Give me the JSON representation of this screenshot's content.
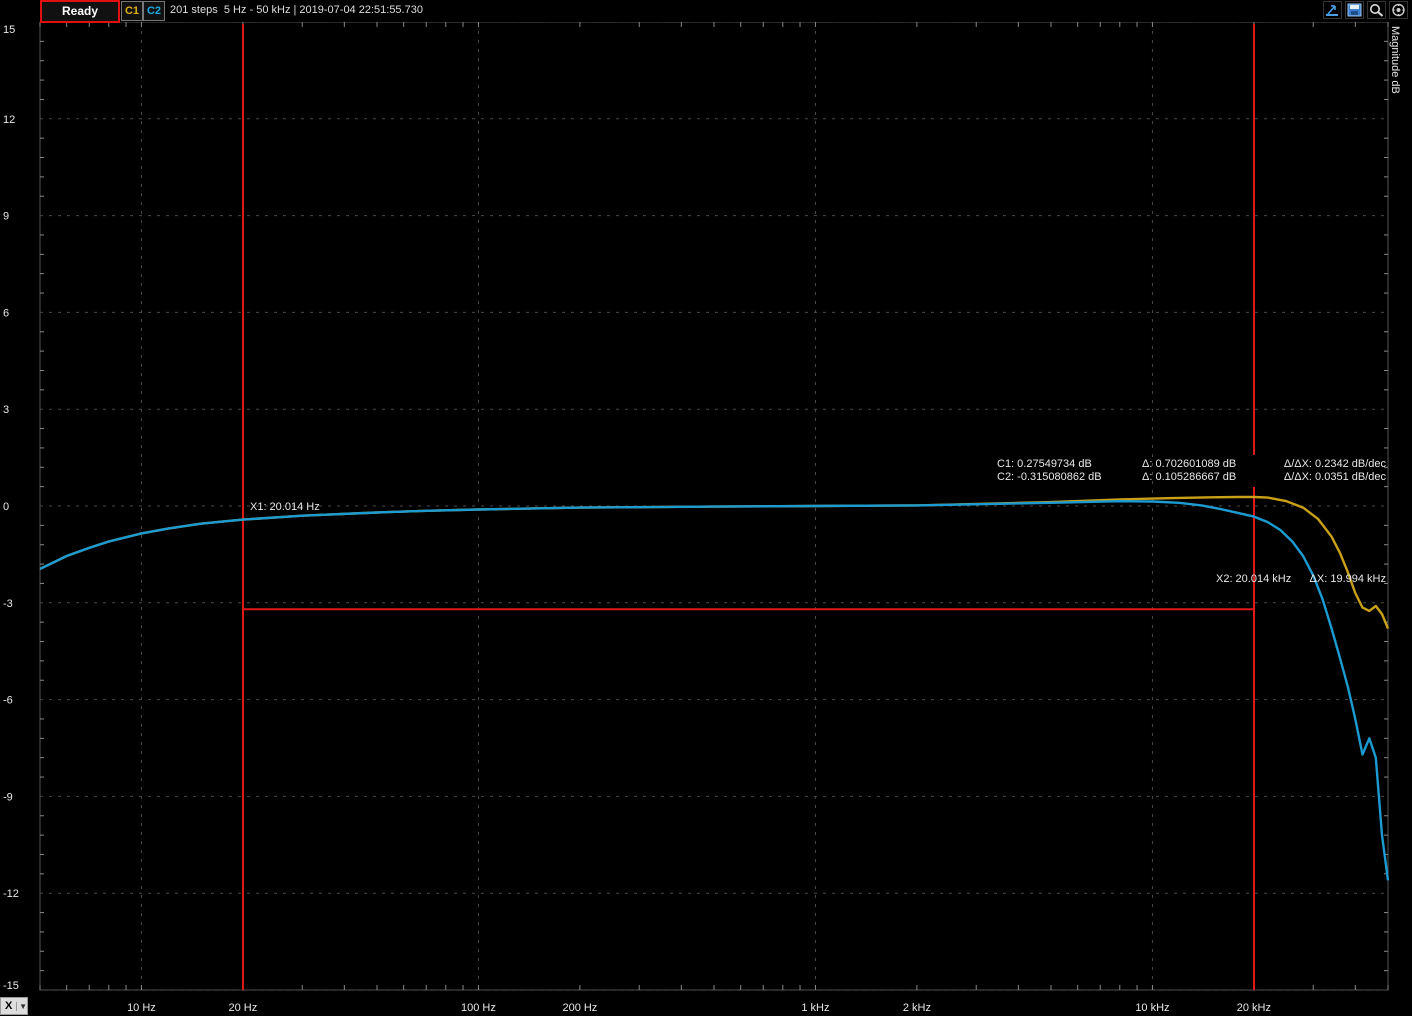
{
  "toolbar": {
    "status": "Ready",
    "channel1_label": "C1",
    "channel2_label": "C2",
    "info": "201 steps  5 Hz - 50 kHz | 2019-07-04 22:51:55.730",
    "icons": [
      "cursor-icon",
      "save-icon",
      "zoom-icon",
      "settings-icon"
    ]
  },
  "x_selector": {
    "label": "X"
  },
  "colors": {
    "c1": "#c9a018",
    "c2": "#1c9bd2",
    "cursor": "#e01818",
    "grid": "#4a4a4a"
  },
  "cursors": {
    "x1_label": "X1: 20.014 Hz",
    "x2_label": "X2: 20.014 kHz",
    "dx_label": "ΔX: 19.994 kHz",
    "c1_value": "C1: 0.27549734 dB",
    "c2_value": "C2: -0.315080862 dB",
    "d1_value": "Δ: 0.702601089 dB",
    "d2_value": "Δ: 0.105286667 dB",
    "s1_value": "Δ/ΔX: 0.2342 dB/dec",
    "s2_value": "Δ/ΔX: 0.0351 dB/dec",
    "x1_hz": 20.014,
    "x2_hz": 20014,
    "y_level_db": -3.2
  },
  "chart_data": {
    "type": "line",
    "title": "",
    "xlabel": "",
    "ylabel": "Magnitude dB",
    "x_scale": "log",
    "xlim": [
      5,
      50000
    ],
    "ylim": [
      -15,
      15
    ],
    "grid": true,
    "y_ticks": [
      "15",
      "12",
      "9",
      "6",
      "3",
      "0",
      "-3",
      "-6",
      "-9",
      "-12",
      "-15"
    ],
    "x_ticks": [
      {
        "hz": 10,
        "label": "10 Hz"
      },
      {
        "hz": 20,
        "label": "20 Hz"
      },
      {
        "hz": 100,
        "label": "100 Hz"
      },
      {
        "hz": 200,
        "label": "200 Hz"
      },
      {
        "hz": 1000,
        "label": "1 kHz"
      },
      {
        "hz": 2000,
        "label": "2 kHz"
      },
      {
        "hz": 10000,
        "label": "10 kHz"
      },
      {
        "hz": 20000,
        "label": "20 kHz"
      }
    ],
    "series": [
      {
        "name": "C1",
        "x": [
          5,
          6,
          7,
          8,
          10,
          12,
          15,
          20,
          30,
          50,
          70,
          100,
          200,
          500,
          1000,
          2000,
          5000,
          8000,
          10000,
          12000,
          15000,
          18000,
          20000,
          22000,
          25000,
          28000,
          31000,
          34000,
          36000,
          38000,
          40000,
          42000,
          44000,
          46000,
          48000,
          50000
        ],
        "y": [
          -1.95,
          -1.55,
          -1.3,
          -1.1,
          -0.85,
          -0.7,
          -0.55,
          -0.42,
          -0.3,
          -0.2,
          -0.15,
          -0.11,
          -0.05,
          -0.02,
          0.0,
          0.02,
          0.12,
          0.2,
          0.23,
          0.25,
          0.27,
          0.28,
          0.28,
          0.26,
          0.15,
          -0.05,
          -0.4,
          -0.95,
          -1.45,
          -2.05,
          -2.7,
          -3.15,
          -3.25,
          -3.1,
          -3.35,
          -3.8
        ]
      },
      {
        "name": "C2",
        "x": [
          5,
          6,
          7,
          8,
          10,
          12,
          15,
          20,
          30,
          50,
          70,
          100,
          200,
          500,
          1000,
          2000,
          5000,
          8000,
          10000,
          12000,
          14000,
          16000,
          18000,
          20000,
          22000,
          24000,
          26000,
          28000,
          30000,
          32000,
          34000,
          36000,
          38000,
          40000,
          42000,
          44000,
          46000,
          48000,
          50000
        ],
        "y": [
          -1.95,
          -1.55,
          -1.3,
          -1.1,
          -0.85,
          -0.7,
          -0.55,
          -0.42,
          -0.3,
          -0.2,
          -0.15,
          -0.11,
          -0.05,
          -0.02,
          0.0,
          0.02,
          0.1,
          0.15,
          0.14,
          0.1,
          0.02,
          -0.1,
          -0.22,
          -0.33,
          -0.5,
          -0.75,
          -1.1,
          -1.55,
          -2.15,
          -2.9,
          -3.8,
          -4.7,
          -5.6,
          -6.6,
          -7.7,
          -7.2,
          -7.8,
          -10.2,
          -11.6
        ]
      }
    ]
  }
}
